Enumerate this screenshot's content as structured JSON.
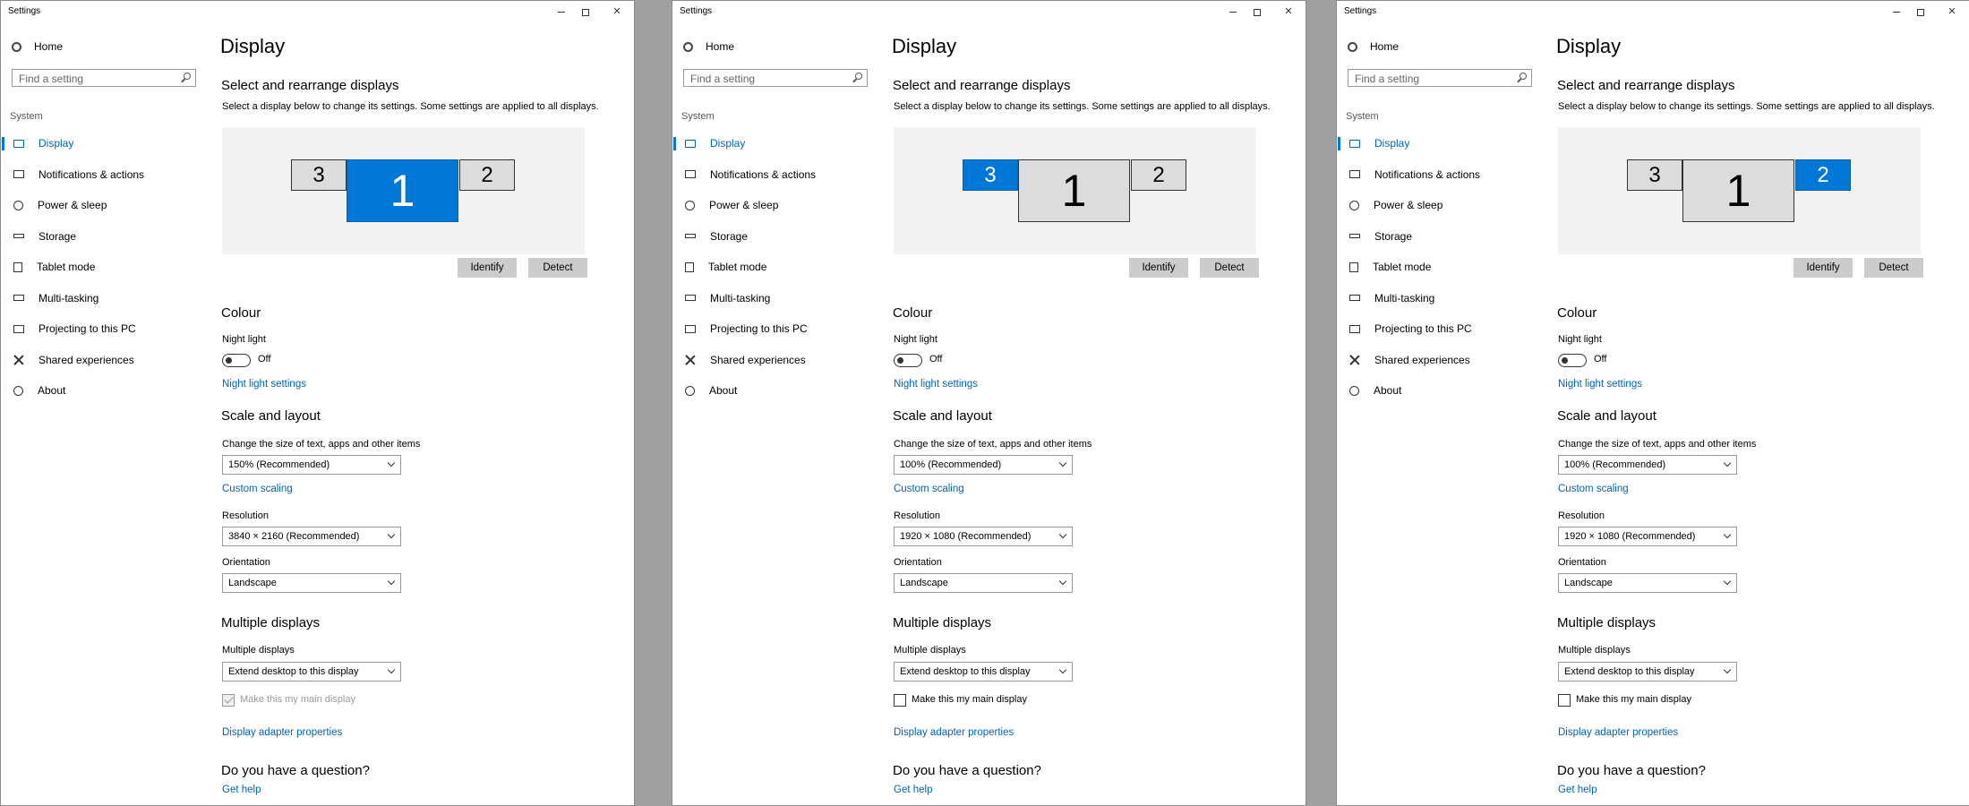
{
  "windows": [
    {
      "title": "Settings",
      "sidebar": {
        "home": "Home",
        "search_placeholder": "Find a setting",
        "section": "System",
        "items": [
          {
            "label": "Display",
            "icon": "monitor-icon",
            "selected": true
          },
          {
            "label": "Notifications & actions",
            "icon": "notifications-icon"
          },
          {
            "label": "Power & sleep",
            "icon": "power-icon"
          },
          {
            "label": "Storage",
            "icon": "storage-icon"
          },
          {
            "label": "Tablet mode",
            "icon": "tablet-icon"
          },
          {
            "label": "Multi-tasking",
            "icon": "multitasking-icon"
          },
          {
            "label": "Projecting to this PC",
            "icon": "projecting-icon"
          },
          {
            "label": "Shared experiences",
            "icon": "shared-experiences-icon"
          },
          {
            "label": "About",
            "icon": "about-icon"
          }
        ]
      },
      "main": {
        "page_title": "Display",
        "arrange_heading": "Select and rearrange displays",
        "arrange_desc": "Select a display below to change its settings. Some settings are applied to all displays.",
        "monitors": [
          {
            "label": "3",
            "selected": false
          },
          {
            "label": "1",
            "selected": true
          },
          {
            "label": "2",
            "selected": false
          }
        ],
        "identify": "Identify",
        "detect": "Detect",
        "colour_heading": "Colour",
        "night_light_label": "Night light",
        "night_light_state": "Off",
        "night_light_settings": "Night light settings",
        "scale_heading": "Scale and layout",
        "scale_label": "Change the size of text, apps and other items",
        "scale_value": "150% (Recommended)",
        "custom_scaling": "Custom scaling",
        "resolution_label": "Resolution",
        "resolution_value": "3840 × 2160 (Recommended)",
        "orientation_label": "Orientation",
        "orientation_value": "Landscape",
        "multi_heading": "Multiple displays",
        "multi_label": "Multiple displays",
        "multi_value": "Extend desktop to this display",
        "main_display_label": "Make this my main display",
        "main_display_checked": true,
        "main_display_disabled": true,
        "adapter_link": "Display adapter properties",
        "question_heading": "Do you have a question?",
        "get_help": "Get help"
      }
    },
    {
      "title": "Settings",
      "sidebar": {
        "home": "Home",
        "search_placeholder": "Find a setting",
        "section": "System",
        "items": [
          {
            "label": "Display",
            "icon": "monitor-icon",
            "selected": true
          },
          {
            "label": "Notifications & actions",
            "icon": "notifications-icon"
          },
          {
            "label": "Power & sleep",
            "icon": "power-icon"
          },
          {
            "label": "Storage",
            "icon": "storage-icon"
          },
          {
            "label": "Tablet mode",
            "icon": "tablet-icon"
          },
          {
            "label": "Multi-tasking",
            "icon": "multitasking-icon"
          },
          {
            "label": "Projecting to this PC",
            "icon": "projecting-icon"
          },
          {
            "label": "Shared experiences",
            "icon": "shared-experiences-icon"
          },
          {
            "label": "About",
            "icon": "about-icon"
          }
        ]
      },
      "main": {
        "page_title": "Display",
        "arrange_heading": "Select and rearrange displays",
        "arrange_desc": "Select a display below to change its settings. Some settings are applied to all displays.",
        "monitors": [
          {
            "label": "3",
            "selected": true
          },
          {
            "label": "1",
            "selected": false
          },
          {
            "label": "2",
            "selected": false
          }
        ],
        "identify": "Identify",
        "detect": "Detect",
        "colour_heading": "Colour",
        "night_light_label": "Night light",
        "night_light_state": "Off",
        "night_light_settings": "Night light settings",
        "scale_heading": "Scale and layout",
        "scale_label": "Change the size of text, apps and other items",
        "scale_value": "100% (Recommended)",
        "custom_scaling": "Custom scaling",
        "resolution_label": "Resolution",
        "resolution_value": "1920 × 1080 (Recommended)",
        "orientation_label": "Orientation",
        "orientation_value": "Landscape",
        "multi_heading": "Multiple displays",
        "multi_label": "Multiple displays",
        "multi_value": "Extend desktop to this display",
        "main_display_label": "Make this my main display",
        "main_display_checked": false,
        "main_display_disabled": false,
        "adapter_link": "Display adapter properties",
        "question_heading": "Do you have a question?",
        "get_help": "Get help"
      }
    },
    {
      "title": "Settings",
      "sidebar": {
        "home": "Home",
        "search_placeholder": "Find a setting",
        "section": "System",
        "items": [
          {
            "label": "Display",
            "icon": "monitor-icon",
            "selected": true
          },
          {
            "label": "Notifications & actions",
            "icon": "notifications-icon"
          },
          {
            "label": "Power & sleep",
            "icon": "power-icon"
          },
          {
            "label": "Storage",
            "icon": "storage-icon"
          },
          {
            "label": "Tablet mode",
            "icon": "tablet-icon"
          },
          {
            "label": "Multi-tasking",
            "icon": "multitasking-icon"
          },
          {
            "label": "Projecting to this PC",
            "icon": "projecting-icon"
          },
          {
            "label": "Shared experiences",
            "icon": "shared-experiences-icon"
          },
          {
            "label": "About",
            "icon": "about-icon"
          }
        ]
      },
      "main": {
        "page_title": "Display",
        "arrange_heading": "Select and rearrange displays",
        "arrange_desc": "Select a display below to change its settings. Some settings are applied to all displays.",
        "monitors": [
          {
            "label": "3",
            "selected": false
          },
          {
            "label": "1",
            "selected": false
          },
          {
            "label": "2",
            "selected": true
          }
        ],
        "identify": "Identify",
        "detect": "Detect",
        "colour_heading": "Colour",
        "night_light_label": "Night light",
        "night_light_state": "Off",
        "night_light_settings": "Night light settings",
        "scale_heading": "Scale and layout",
        "scale_label": "Change the size of text, apps and other items",
        "scale_value": "100% (Recommended)",
        "custom_scaling": "Custom scaling",
        "resolution_label": "Resolution",
        "resolution_value": "1920 × 1080 (Recommended)",
        "orientation_label": "Orientation",
        "orientation_value": "Landscape",
        "multi_heading": "Multiple displays",
        "multi_label": "Multiple displays",
        "multi_value": "Extend desktop to this display",
        "main_display_label": "Make this my main display",
        "main_display_checked": false,
        "main_display_disabled": false,
        "adapter_link": "Display adapter properties",
        "question_heading": "Do you have a question?",
        "get_help": "Get help"
      }
    }
  ],
  "colors": {
    "accent": "#0078d7",
    "link": "#0063b1",
    "monitor_idle": "#dcdcdc",
    "canvas": "#f2f2f2"
  }
}
